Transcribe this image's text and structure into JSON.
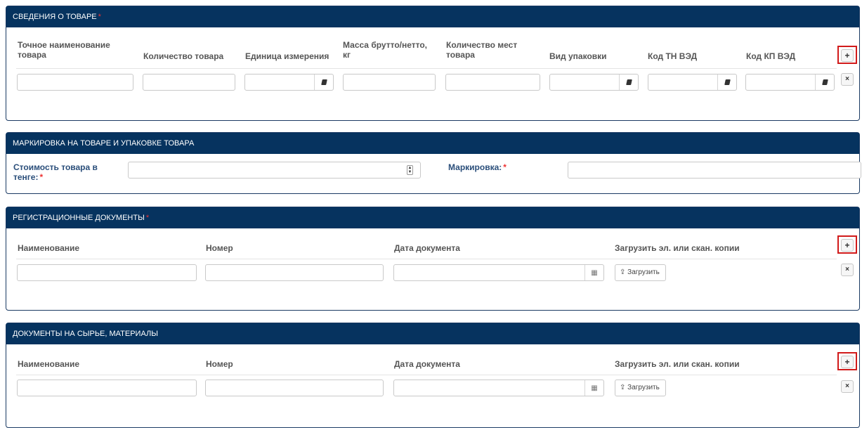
{
  "goods": {
    "title": "СВЕДЕНИЯ О ТОВАРЕ",
    "required_mark": "*",
    "columns": [
      "Точное наименование товара",
      "Количество товара",
      "Единица измерения",
      "Масса брутто/нетто, кг",
      "Количество мест товара",
      "Вид упаковки",
      "Код ТН ВЭД",
      "Код КП ВЭД"
    ],
    "add_label": "+",
    "delete_label": "×"
  },
  "marking": {
    "title": "МАРКИРОВКА НА ТОВАРЕ И УПАКОВКЕ ТОВАРА",
    "cost_label_line1": "Стоимость товара в",
    "cost_label_line2": "тенге:",
    "marking_label": "Маркировка:",
    "required_mark": "*"
  },
  "registration_docs": {
    "title": "РЕГИСТРАЦИОННЫЕ ДОКУМЕНТЫ",
    "required_mark": "*",
    "columns": [
      "Наименование",
      "Номер",
      "Дата документа",
      "Загрузить эл. или скан. копии"
    ],
    "upload_label": "Загрузить",
    "add_label": "+",
    "delete_label": "×"
  },
  "material_docs": {
    "title": "ДОКУМЕНТЫ НА СЫРЬЕ, МАТЕРИАЛЫ",
    "columns": [
      "Наименование",
      "Номер",
      "Дата документа",
      "Загрузить эл. или скан. копии"
    ],
    "upload_label": "Загрузить",
    "add_label": "+",
    "delete_label": "×"
  },
  "colors": {
    "header_bg": "#06335f",
    "highlight": "#d11a1a",
    "required": "#e33333"
  }
}
